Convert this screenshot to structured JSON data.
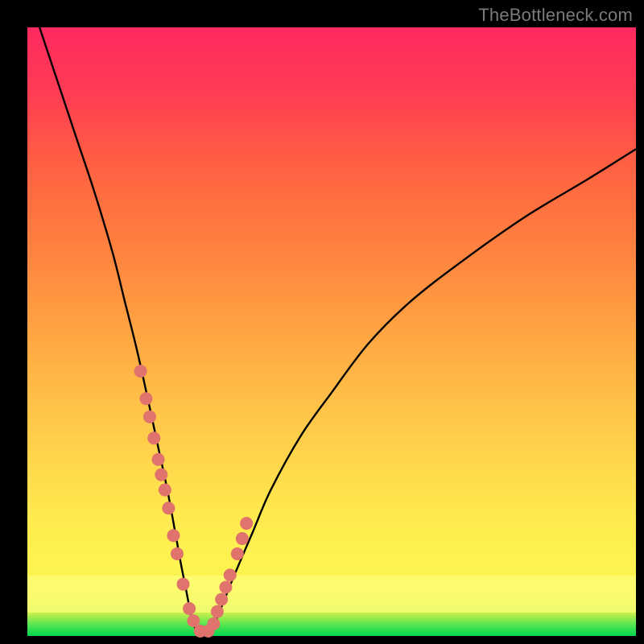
{
  "watermark": "TheBottleneck.com",
  "chart_data": {
    "type": "line",
    "title": "",
    "xlabel": "",
    "ylabel": "",
    "xlim": [
      0,
      100
    ],
    "ylim": [
      0,
      100
    ],
    "series": [
      {
        "name": "bottleneck-curve",
        "x": [
          2,
          5,
          8,
          11,
          14,
          16,
          18,
          20,
          21.5,
          23,
          24.3,
          25.2,
          26,
          27,
          28,
          29.3,
          30.7,
          32,
          34,
          37,
          40,
          45,
          50,
          56,
          63,
          72,
          82,
          92,
          100
        ],
        "y": [
          100,
          91,
          82,
          73,
          63,
          55,
          47,
          38,
          31,
          24,
          17,
          12,
          8,
          3,
          0.5,
          0.5,
          2,
          5,
          10,
          17,
          24,
          33,
          40,
          48,
          55,
          62,
          69,
          75,
          80
        ]
      }
    ],
    "markers": {
      "name": "highlight-dots",
      "x": [
        18.6,
        19.5,
        20.1,
        20.8,
        21.5,
        22.0,
        22.6,
        23.2,
        24.0,
        24.6,
        25.6,
        26.6,
        27.3,
        28.4,
        29.7,
        30.6,
        31.2,
        31.9,
        32.6,
        33.3,
        34.5,
        35.3,
        36.0
      ],
      "y": [
        43.5,
        39.0,
        36.0,
        32.5,
        29.0,
        26.5,
        24.0,
        21.0,
        16.5,
        13.5,
        8.5,
        4.5,
        2.5,
        0.8,
        0.8,
        2.0,
        4.0,
        6.0,
        8.0,
        10.0,
        13.5,
        16.0,
        18.5
      ]
    },
    "background": {
      "gradient_top_color": "#ff2a60",
      "gradient_mid_color": "#ffe94f",
      "gradient_bottom_color": "#00d850",
      "highlight_band_color": "#ffff82"
    }
  }
}
